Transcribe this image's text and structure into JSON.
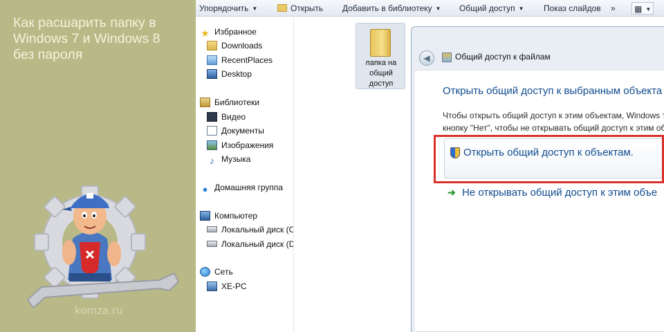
{
  "promo": {
    "title_lines": [
      "Как расшарить папку в",
      "Windows 7 и Windows 8",
      "без пароля"
    ],
    "site": "komza.ru"
  },
  "toolbar": {
    "organize": "Упорядочить",
    "open": "Открыть",
    "add_to_library": "Добавить в библиотеку",
    "share": "Общий доступ",
    "slideshow": "Показ слайдов"
  },
  "nav": {
    "favorites": "Избранное",
    "downloads": "Downloads",
    "recent_places": "RecentPlaces",
    "desktop": "Desktop",
    "libraries": "Библиотеки",
    "video": "Видео",
    "documents": "Документы",
    "images": "Изображения",
    "music": "Музыка",
    "homegroup": "Домашняя группа",
    "computer": "Компьютер",
    "local_disk_c": "Локальный диск (C",
    "local_disk_d": "Локальный диск (D",
    "network": "Сеть",
    "pc": "XE-PC"
  },
  "content": {
    "folder_label_lines": [
      "папка на",
      "общий",
      "доступ"
    ]
  },
  "dialog": {
    "title": "Общий доступ к файлам",
    "heading": "Открыть общий доступ к выбранным объекта",
    "desc_line1": "Чтобы открыть общий доступ к этим объектам, Windows тр",
    "desc_line2": "кнопку \"Нет\", чтобы не открывать общий доступ к этим об",
    "option_share": "Открыть общий доступ к объектам.",
    "option_no_share": "Не открывать общий доступ к этим объе"
  }
}
